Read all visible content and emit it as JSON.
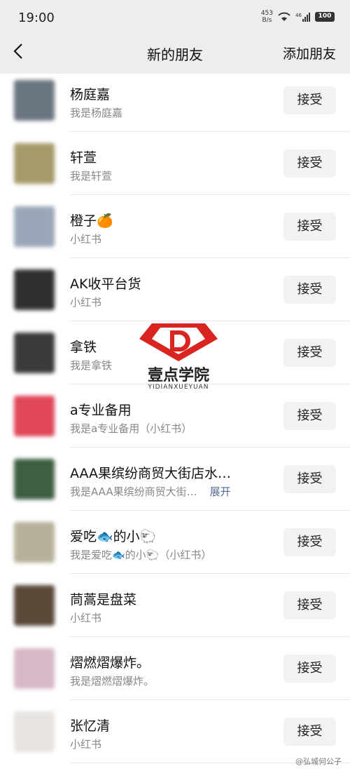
{
  "status": {
    "time": "19:00",
    "net_speed_top": "453",
    "net_speed_unit": "B/s",
    "signal": "46",
    "battery": "100"
  },
  "header": {
    "title": "新的朋友",
    "action": "添加朋友"
  },
  "accept_label": "接受",
  "rows": [
    {
      "name": "杨庭嘉",
      "sub": "我是杨庭嘉",
      "avatar_color": "#6b7580"
    },
    {
      "name": "轩萱",
      "sub": "我是轩萱",
      "avatar_color": "#a59a6a"
    },
    {
      "name": "橙子🍊",
      "sub": "小红书",
      "avatar_color": "#9aa7b8"
    },
    {
      "name": "AK收平台货",
      "sub": "小红书",
      "avatar_color": "#2f3130"
    },
    {
      "name": "拿铁",
      "sub": "我是拿铁",
      "avatar_color": "#3a3a3a"
    },
    {
      "name": "a专业备用",
      "sub": "我是a专业备用（小红书）",
      "avatar_color": "#e0485a"
    },
    {
      "name": "AAA果缤纷商贸大街店水…",
      "sub": "我是AAA果缤纷商贸大街…",
      "expand": "展开",
      "avatar_color": "#3f5f43"
    },
    {
      "name": "爱吃🐟的小🐑",
      "sub": "我是爱吃🐟的小🐑（小红书）",
      "avatar_color": "#b7b09a"
    },
    {
      "name": "茼蒿是盘菜",
      "sub": "小红书",
      "avatar_color": "#5a4a3a"
    },
    {
      "name": "熠燃熠爆炸。",
      "sub": "我是熠燃熠爆炸。",
      "avatar_color": "#d7b8c8"
    },
    {
      "name": "张忆清",
      "sub": "小红书",
      "avatar_color": "#e8e3e0"
    }
  ],
  "logo": {
    "text": "壹点学院",
    "pinyin": "YIDIANXUEYUAN"
  },
  "watermark": "@弘城何公子"
}
